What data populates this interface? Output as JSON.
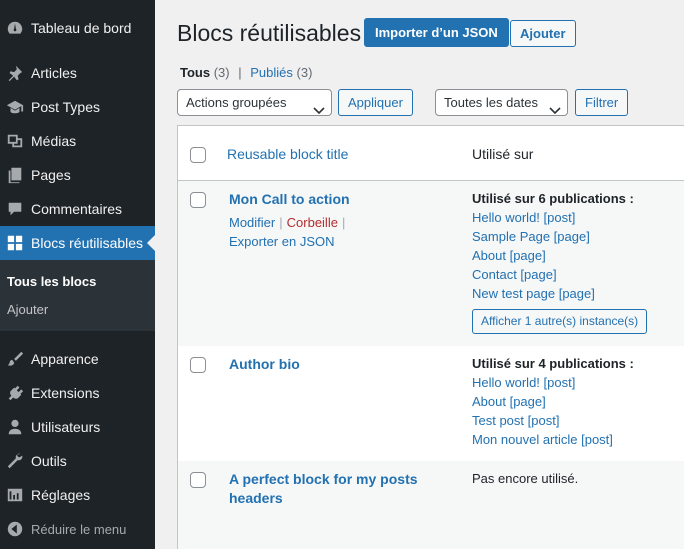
{
  "sidebar": {
    "items": [
      {
        "label": "Tableau de bord",
        "icon": "dashboard-icon"
      },
      {
        "label": "Articles",
        "icon": "pin-icon"
      },
      {
        "label": "Post Types",
        "icon": "graduation-cap-icon"
      },
      {
        "label": "Médias",
        "icon": "media-icon"
      },
      {
        "label": "Pages",
        "icon": "pages-icon"
      },
      {
        "label": "Commentaires",
        "icon": "comment-icon"
      },
      {
        "label": "Blocs réutilisables",
        "icon": "blocks-icon"
      },
      {
        "label": "Apparence",
        "icon": "paintbrush-icon"
      },
      {
        "label": "Extensions",
        "icon": "plugin-icon"
      },
      {
        "label": "Utilisateurs",
        "icon": "user-icon"
      },
      {
        "label": "Outils",
        "icon": "wrench-icon"
      },
      {
        "label": "Réglages",
        "icon": "settings-icon"
      }
    ],
    "submenu": [
      "Tous les blocs",
      "Ajouter"
    ],
    "collapse_label": "Réduire le menu"
  },
  "header": {
    "title": "Blocs réutilisables",
    "import_label": "Importer d’un JSON",
    "add_label": "Ajouter"
  },
  "filters": {
    "all_label": "Tous",
    "all_count": "(3)",
    "published_label": "Publiés",
    "published_count": "(3)",
    "separator": "|",
    "bulk_actions": "Actions groupées",
    "apply_label": "Appliquer",
    "dates": "Toutes les dates",
    "filter_label": "Filtrer"
  },
  "table": {
    "col_title": "Reusable block title",
    "col_used": "Utilisé sur",
    "rows": [
      {
        "title": "Mon Call to action",
        "actions": {
          "edit": "Modifier",
          "trash": "Corbeille",
          "export": "Exporter en JSON",
          "sep": "|"
        },
        "used_head": "Utilisé sur 6 publications :",
        "used_links": [
          "Hello world! [post]",
          "Sample Page [page]",
          "About [page]",
          "Contact [page]",
          "New test page [page]"
        ],
        "show_more": "Afficher 1 autre(s) instance(s)"
      },
      {
        "title": "Author bio",
        "used_head": "Utilisé sur 4 publications :",
        "used_links": [
          "Hello world! [post]",
          "About [page]",
          "Test post [post]",
          "Mon nouvel article [post]"
        ]
      },
      {
        "title_line1": "A perfect block for my posts",
        "title_line2": "headers",
        "used_none": "Pas encore utilisé."
      }
    ]
  },
  "colors": {
    "sidebar_bg": "#1d2327",
    "accent": "#2271b1",
    "trash": "#b32d2e"
  }
}
